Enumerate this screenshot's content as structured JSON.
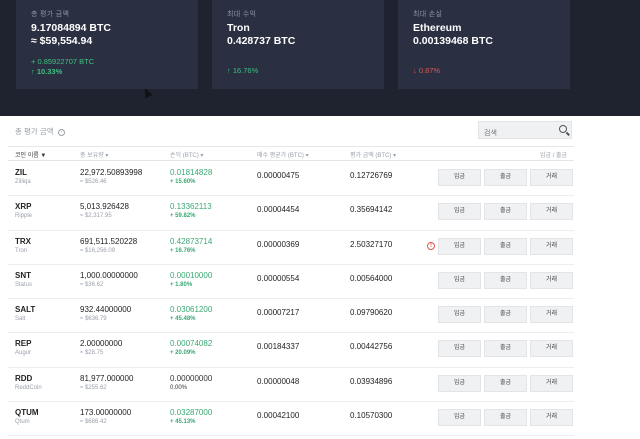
{
  "summary": {
    "total": {
      "label": "총 평가 금액",
      "btc": "9.17084894 BTC",
      "usd": "≈ $59,554.94",
      "change_btc": "+ 0.85922707 BTC",
      "change_pct": "↑ 10.33%"
    },
    "max_gain": {
      "label": "최대 수익",
      "coin": "Tron",
      "btc": "0.428737 BTC",
      "change_pct": "↑ 16.76%"
    },
    "max_loss": {
      "label": "최대 손실",
      "coin": "Ethereum",
      "btc": "0.00139468 BTC",
      "change_pct": "↓ 0.87%"
    }
  },
  "colors": {
    "dark_bg": "#1f2330",
    "card_bg": "#2a3042",
    "positive": "#3aa874",
    "negative": "#e05555"
  },
  "section": {
    "title": "총 평가 금액",
    "help_icon": "question-circle-icon"
  },
  "search": {
    "placeholder": "검색",
    "icon": "search-icon"
  },
  "table": {
    "headers": {
      "coin": "코인 이름 ▼",
      "holdings": "총 보유량 ▾",
      "pl": "손익 (BTC) ▾",
      "buy": "매수 평균가 (BTC) ▾",
      "cur": "평가 금액 (BTC) ▾",
      "actions": "입금 / 출금"
    },
    "buttons": {
      "deposit": "입금",
      "withdraw": "출금",
      "trade": "거래"
    },
    "rows": [
      {
        "symbol": "ZIL",
        "name": "Zilliqa",
        "holdings": "22,972.50893998",
        "holdings_usd": "≈ $526.46",
        "pl": "0.01814828",
        "pl_pct": "+ 15.60%",
        "buy": "0.00000475",
        "cur": "0.12726769",
        "warn": false
      },
      {
        "symbol": "XRP",
        "name": "Ripple",
        "holdings": "5,013.926428",
        "holdings_usd": "≈ $2,317.95",
        "pl": "0.13362113",
        "pl_pct": "+ 59.82%",
        "buy": "0.00004454",
        "cur": "0.35694142",
        "warn": false
      },
      {
        "symbol": "TRX",
        "name": "Tron",
        "holdings": "691,511.520228",
        "holdings_usd": "≈ $16,256.09",
        "pl": "0.42873714",
        "pl_pct": "+ 16.76%",
        "buy": "0.00000369",
        "cur": "2.50327170",
        "warn": true
      },
      {
        "symbol": "SNT",
        "name": "Status",
        "holdings": "1,000.00000000",
        "holdings_usd": "≈ $36.62",
        "pl": "0.00010000",
        "pl_pct": "+ 1.80%",
        "buy": "0.00000554",
        "cur": "0.00564000",
        "warn": false
      },
      {
        "symbol": "SALT",
        "name": "Salt",
        "holdings": "932.44000000",
        "holdings_usd": "≈ $636.79",
        "pl": "0.03061200",
        "pl_pct": "+ 45.48%",
        "buy": "0.00007217",
        "cur": "0.09790620",
        "warn": false
      },
      {
        "symbol": "REP",
        "name": "Augur",
        "holdings": "2.00000000",
        "holdings_usd": "≈ $28.75",
        "pl": "0.00074082",
        "pl_pct": "+ 20.09%",
        "buy": "0.00184337",
        "cur": "0.00442756",
        "warn": false
      },
      {
        "symbol": "RDD",
        "name": "ReddCoin",
        "holdings": "81,977.000000",
        "holdings_usd": "≈ $255.62",
        "pl": "0.00000000",
        "pl_pct": "0.00%",
        "buy": "0.00000048",
        "cur": "0.03934896",
        "warn": false
      },
      {
        "symbol": "QTUM",
        "name": "Qtum",
        "holdings": "173.00000000",
        "holdings_usd": "≈ $686.42",
        "pl": "0.03287000",
        "pl_pct": "+ 45.13%",
        "buy": "0.00042100",
        "cur": "0.10570300",
        "warn": false
      }
    ]
  }
}
